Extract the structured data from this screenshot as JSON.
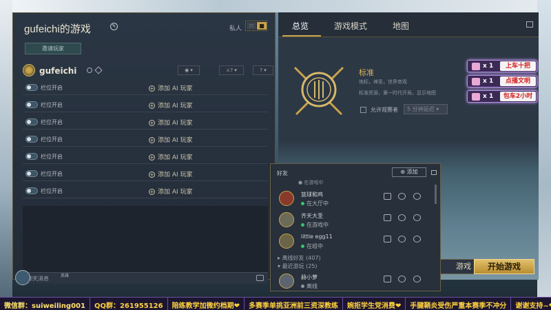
{
  "lobby": {
    "title": "gufeichi的游戏",
    "private_label": "私人",
    "invite_label": "邀请玩家",
    "host_name": "gufeichi",
    "slots": [
      {
        "label": "栏位开启",
        "add": "添加 AI 玩家"
      },
      {
        "label": "栏位开启",
        "add": "添加 AI 玩家"
      },
      {
        "label": "栏位开启",
        "add": "添加 AI 玩家"
      },
      {
        "label": "栏位开启",
        "add": "添加 AI 玩家"
      },
      {
        "label": "栏位开启",
        "add": "添加 AI 玩家"
      },
      {
        "label": "栏位开启",
        "add": "添加 AI 玩家"
      },
      {
        "label": "栏位开启",
        "add": "添加 AI 玩家"
      }
    ],
    "chat_label": "聊天消息"
  },
  "settings": {
    "tabs": [
      "总览",
      "游戏模式",
      "地图"
    ],
    "mode_name": "标准",
    "mode_desc": "地标，神圣，世界帝观",
    "mode_desc2": "标准资源，第一时代开局，显示地图",
    "spectator_label": "允许观赛者",
    "delay_value": "5 分钟延迟",
    "leave_label": "游戏",
    "start_label": "开始游戏"
  },
  "rewards": [
    {
      "count": "x 1",
      "text": "上车十把"
    },
    {
      "count": "x 1",
      "text": "点播文明"
    },
    {
      "count": "x 1",
      "text": "包车2小时"
    }
  ],
  "friends": {
    "title": "好友",
    "add_label": "添加",
    "partial_status": "在游戏中",
    "list": [
      {
        "name": "篮球和鸡",
        "status": "在大厅中",
        "online": true
      },
      {
        "name": "齐天大圣",
        "status": "在游戏中",
        "online": true
      },
      {
        "name": "little egg11",
        "status": "在组中",
        "online": true
      }
    ],
    "offline_group": "离线好友 (407)",
    "recent_group": "最近游玩 (25)",
    "recent": [
      {
        "name": "赫小萝",
        "status": "离线",
        "online": false
      }
    ]
  },
  "bottom_label": "英雄",
  "ticker": [
    "微信群：suiweiling001",
    "QQ群：261955126",
    "陪练教学加微约档期❤",
    "多赛季单挑亚洲前三资深教练",
    "婉拒学生党消费❤",
    "手腱鞘炎受伤严重本赛季不冲分",
    "谢谢支持~❤"
  ]
}
